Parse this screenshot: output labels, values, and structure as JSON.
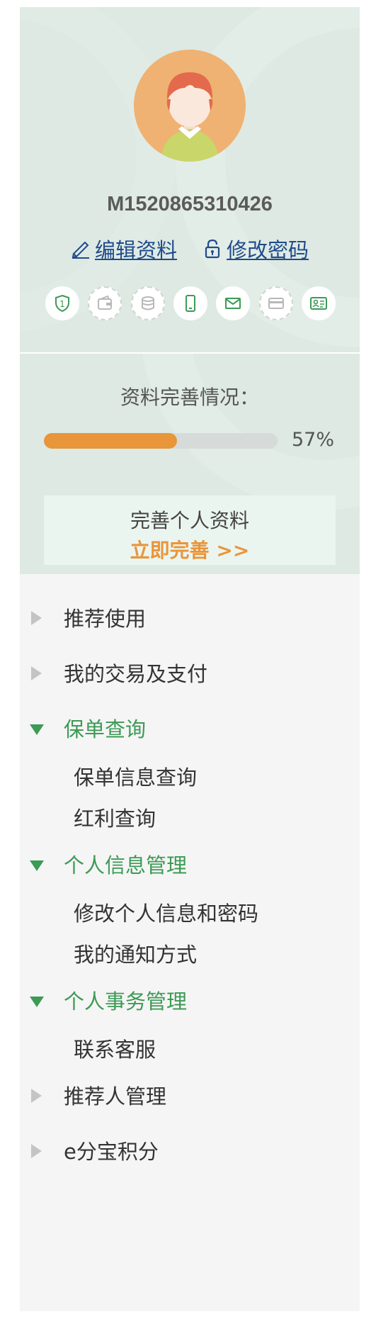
{
  "profile": {
    "username": "M1520865310426",
    "edit_profile_label": "编辑资料",
    "change_password_label": "修改密码",
    "badges": [
      {
        "icon": "shield-1-icon",
        "active": true
      },
      {
        "icon": "wallet-icon",
        "active": false
      },
      {
        "icon": "coins-icon",
        "active": false
      },
      {
        "icon": "phone-icon",
        "active": true
      },
      {
        "icon": "mail-icon",
        "active": true
      },
      {
        "icon": "bank-card-icon",
        "active": false
      },
      {
        "icon": "id-card-icon",
        "active": true
      }
    ]
  },
  "completion": {
    "title": "资料完善情况：",
    "percent_value": 0.57,
    "percent_text": "57%",
    "box_text": "完善个人资料",
    "action_text": "立即完善 >>"
  },
  "menu": {
    "items": [
      {
        "label": "推荐使用",
        "expanded": false
      },
      {
        "label": "我的交易及支付",
        "expanded": false
      },
      {
        "label": "保单查询",
        "expanded": true,
        "children": [
          "保单信息查询",
          "红利查询"
        ]
      },
      {
        "label": "个人信息管理",
        "expanded": true,
        "children": [
          "修改个人信息和密码",
          "我的通知方式"
        ]
      },
      {
        "label": "个人事务管理",
        "expanded": true,
        "children": [
          "联系客服"
        ]
      },
      {
        "label": "推荐人管理",
        "expanded": false
      },
      {
        "label": "e分宝积分",
        "expanded": false
      }
    ]
  },
  "colors": {
    "header_bg": "#dde9e2",
    "accent_green": "#3c9a55",
    "accent_orange": "#e9953a",
    "link_blue": "#1f4b8c",
    "menu_bg": "#f5f5f5"
  }
}
